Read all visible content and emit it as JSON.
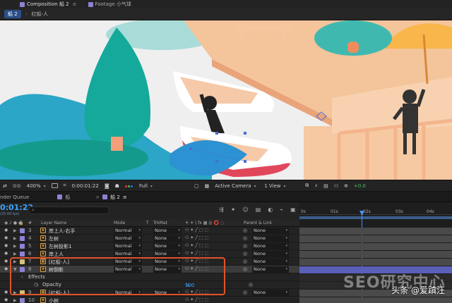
{
  "top_tabs": [
    {
      "label": "Composition 船 2",
      "color": "#8c82d6",
      "active": true
    },
    {
      "label": "Footage 小气球",
      "color": "#8c82d6",
      "active": false
    }
  ],
  "breadcrumbs": {
    "active": "船 2",
    "next": "红船-人"
  },
  "viewer_toolbar": {
    "zoom": "400%",
    "time": "0:00:01:22",
    "resolution": "Full",
    "camera": "Active Camera",
    "views": "1 View",
    "exposure": "+0.0"
  },
  "panel_tabs": [
    {
      "label": "nder Queue",
      "active": false
    },
    {
      "label": "船",
      "active": false
    },
    {
      "label": "船 2",
      "active": true
    }
  ],
  "timeline": {
    "timecode": "0:01:22",
    "fps": "(25.00 fps)",
    "search_placeholder": "⌕",
    "ruler_ticks": [
      "0s",
      "01s",
      "02s",
      "03s",
      "04s"
    ]
  },
  "columns": {
    "layer_name": "Layer Name",
    "mode": "Mode",
    "t": "T",
    "trkmat": "TrkMat",
    "switches": "☀ ✴ \\ fx ▦ ◎ ⭕ ◌",
    "parent": "Parent & Link"
  },
  "layers": [
    {
      "num": "3",
      "name": "岸上人-右手",
      "color": "#8c82d6",
      "mode": "Normal",
      "trkmat": "None",
      "parent": "None",
      "type_glyph": "★"
    },
    {
      "num": "4",
      "name": "左树",
      "color": "#8c82d6",
      "mode": "Normal",
      "trkmat": "None",
      "parent": "None",
      "type_glyph": "★"
    },
    {
      "num": "5",
      "name": "左树投影1",
      "color": "#8c82d6",
      "mode": "Normal",
      "trkmat": "None",
      "parent": "None",
      "type_glyph": "★"
    },
    {
      "num": "6",
      "name": "岸上人",
      "color": "#8c82d6",
      "mode": "Normal",
      "trkmat": "None",
      "parent": "None",
      "type_glyph": "★"
    },
    {
      "num": "7",
      "name": "[红船-人]",
      "color": "#d6c07a",
      "mode": "Normal",
      "trkmat": "None",
      "parent": "None",
      "type_glyph": "▦"
    },
    {
      "num": "8",
      "name": "树倒影",
      "color": "#8c82d6",
      "mode": "Normal",
      "trkmat": "None",
      "parent": "None",
      "type_glyph": "★"
    }
  ],
  "effects_label": "Effects",
  "opacity": {
    "label": "Opacity",
    "value": "100",
    "unit": "%"
  },
  "layers_after": [
    {
      "num": "9",
      "name": "[红船-人]",
      "color": "#d6c07a",
      "mode": "Normal",
      "trkmat": "None",
      "parent": "None",
      "type_glyph": "▦"
    },
    {
      "num": "10",
      "name": "小树",
      "color": "#8c82d6",
      "mode": "",
      "trkmat": "",
      "parent": "",
      "type_glyph": "★"
    }
  ],
  "watermark": "头条 @爱蹎汪",
  "watermark_seo": "SEO研究中心",
  "colors": {
    "accent": "#3fa3ff",
    "highlight": "#e0532a",
    "water": "#2ba6c6",
    "wood": "#f4c49a",
    "tree": "#15a99b"
  }
}
